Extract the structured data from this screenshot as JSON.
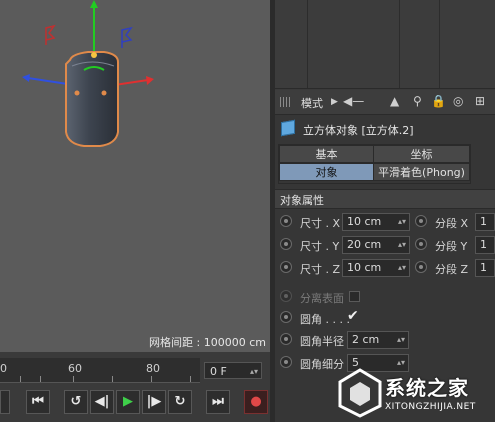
{
  "viewport": {
    "grid_spacing_label": "网格间距 : 100000 cm"
  },
  "timeline": {
    "ticks": [
      "0",
      "60",
      "80"
    ],
    "frame_value": "0 F",
    "controls": [
      "⏮",
      "↺",
      "◀|",
      "▶",
      "|▶",
      "↻",
      "⏭",
      "●"
    ]
  },
  "attributes": {
    "toolbar": {
      "mode_label": "模式"
    },
    "object_title": "立方体对象 [立方体.2]",
    "tabs": [
      {
        "label": "基本",
        "active": false
      },
      {
        "label": "坐标",
        "active": false
      },
      {
        "label": "对象",
        "active": true
      },
      {
        "label": "平滑着色(Phong)",
        "active": false
      }
    ],
    "section_title": "对象属性",
    "size_rows": [
      {
        "label": "尺寸 . X",
        "value": "10 cm",
        "seg_label": "分段 X",
        "seg_value": "1"
      },
      {
        "label": "尺寸 . Y",
        "value": "20 cm",
        "seg_label": "分段 Y",
        "seg_value": "1"
      },
      {
        "label": "尺寸 . Z",
        "value": "10 cm",
        "seg_label": "分段 Z",
        "seg_value": "1"
      }
    ],
    "separate_surfaces_label": "分离表面",
    "fillet_label": "圆角 . . . .",
    "fillet_checked": true,
    "fillet_radius_label": "圆角半径",
    "fillet_radius_value": "2 cm",
    "fillet_subdivision_label": "圆角细分",
    "fillet_subdivision_value": "5"
  },
  "watermark": {
    "text": "系统之家",
    "url": "XITONGZHIJIA.NET"
  },
  "colors": {
    "viewport_bg": "#5b5b5b",
    "active_tab": "#7f99b8",
    "play_green": "#3fd04a",
    "axis_y": "#22cc22",
    "axis_x": "#e03030",
    "axis_z": "#3050e0",
    "selection_outline": "#e08a4a"
  }
}
